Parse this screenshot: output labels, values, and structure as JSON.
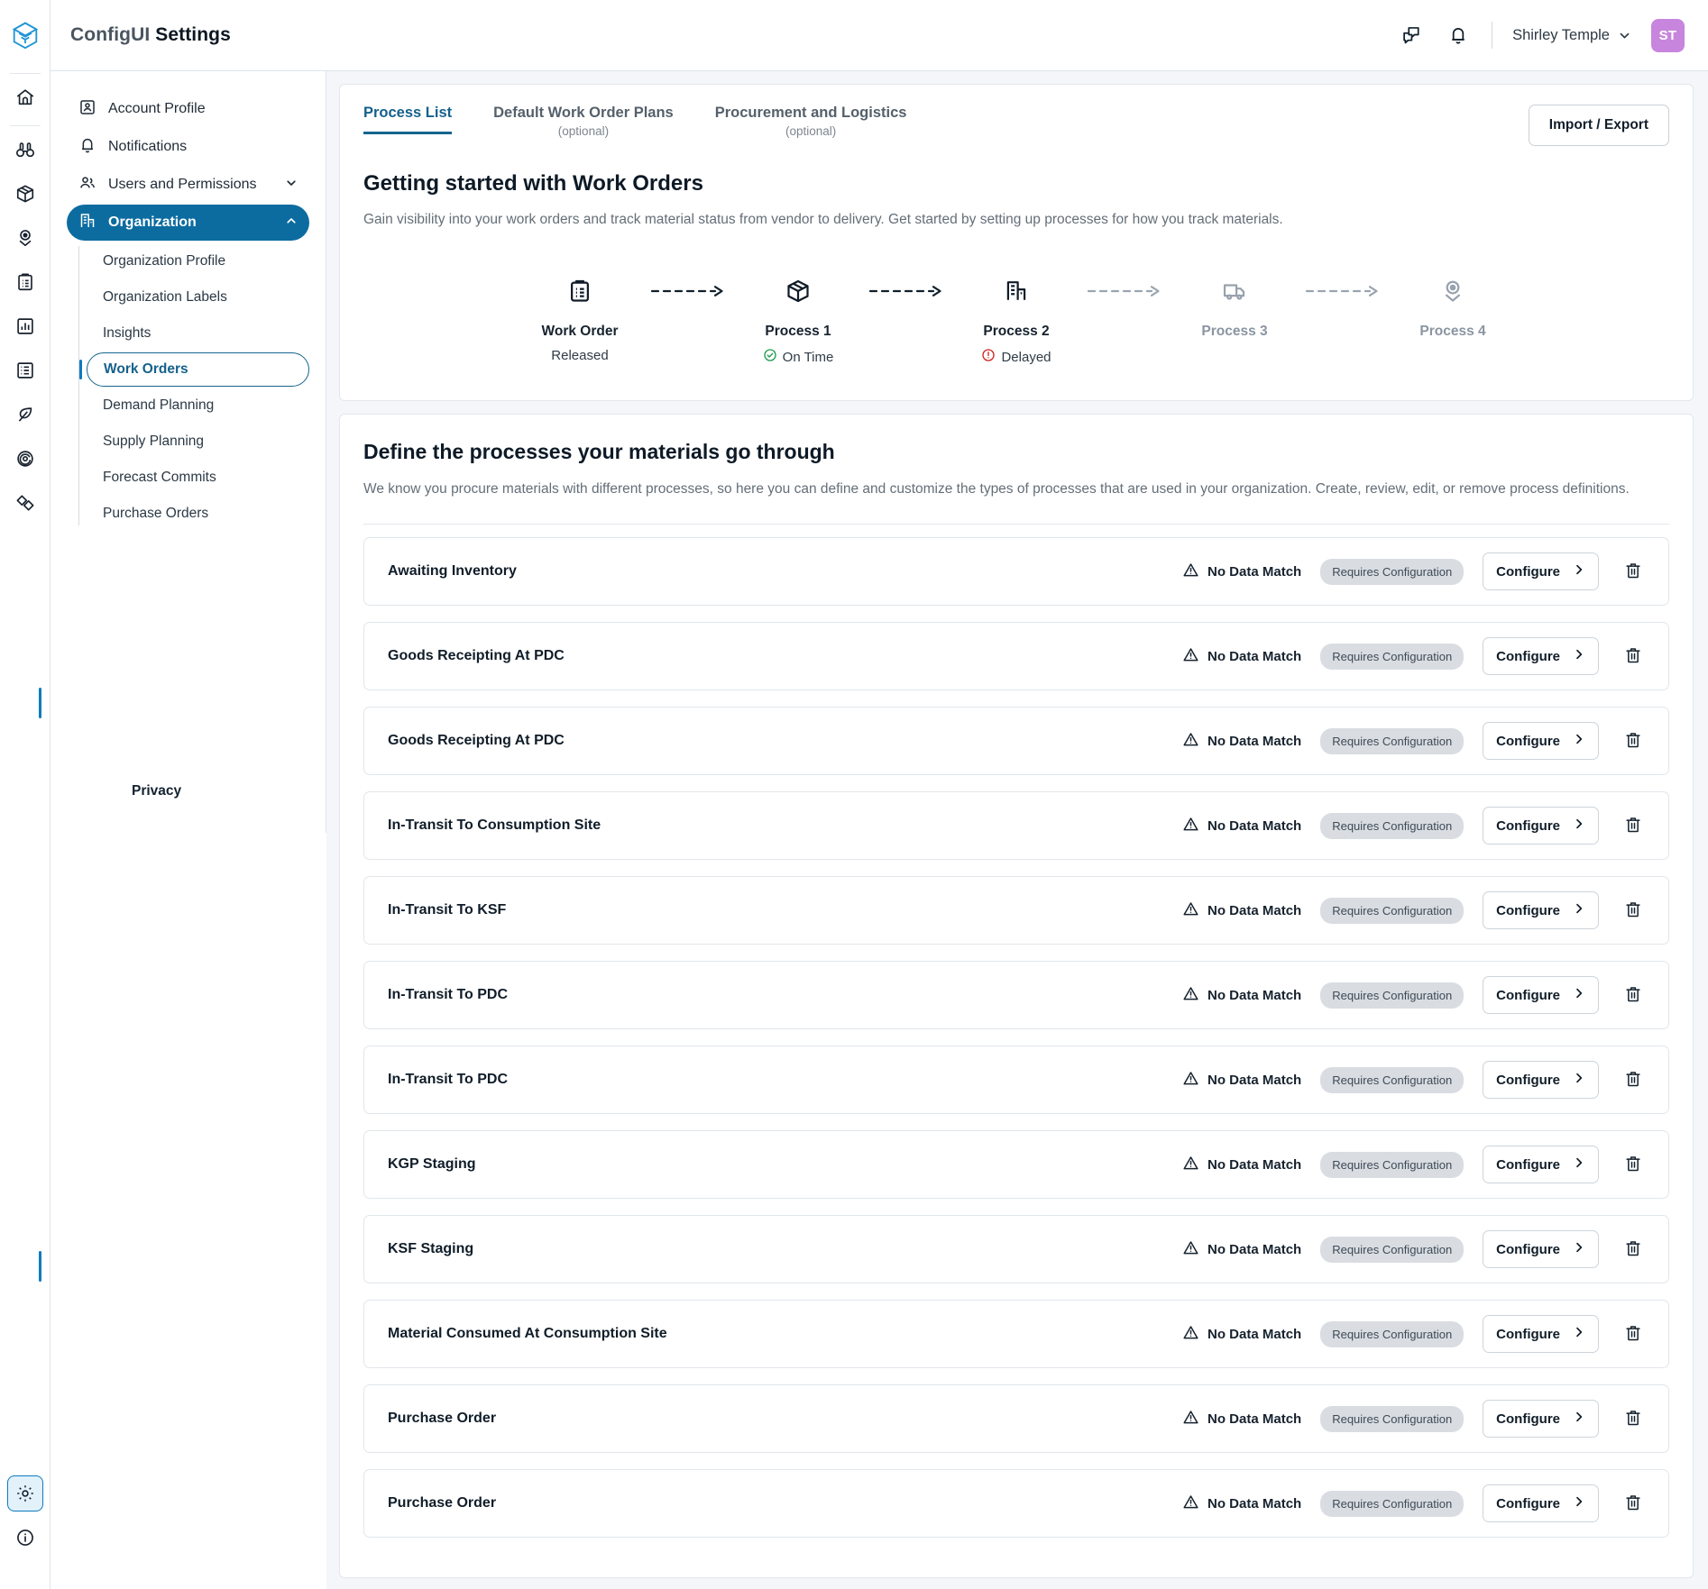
{
  "app": {
    "brand_light": "ConfigUI",
    "brand_bold": "Settings",
    "logo_icon": "cube-logo-icon"
  },
  "header": {
    "chat_icon": "chat-bubbles-icon",
    "bell_icon": "bell-icon",
    "user_name": "Shirley Temple",
    "user_chevron_icon": "chevron-down-icon",
    "avatar_initials": "ST",
    "avatar_color": "#c885dd"
  },
  "rail": {
    "items": [
      {
        "name": "home-icon"
      },
      {
        "name": "binoculars-icon"
      },
      {
        "name": "package-icon"
      },
      {
        "name": "location-pin-icon"
      },
      {
        "name": "clipboard-list-icon"
      },
      {
        "name": "bar-chart-icon"
      },
      {
        "name": "list-checks-icon"
      },
      {
        "name": "leaf-icon"
      },
      {
        "name": "target-spiral-icon"
      },
      {
        "name": "diamonds-icon"
      }
    ],
    "bottom_items": [
      {
        "name": "gear-icon",
        "active": true
      },
      {
        "name": "info-icon",
        "active": false
      }
    ]
  },
  "sidebar": {
    "items": [
      {
        "label": "Account Profile",
        "icon": "account-badge-icon",
        "selected": false,
        "expandable": false
      },
      {
        "label": "Notifications",
        "icon": "bell-icon",
        "selected": false,
        "expandable": false
      },
      {
        "label": "Users and Permissions",
        "icon": "users-icon",
        "selected": false,
        "expandable": true,
        "chevron": "chevron-down-icon"
      },
      {
        "label": "Organization",
        "icon": "building-icon",
        "selected": true,
        "expandable": true,
        "chevron": "chevron-up-icon"
      }
    ],
    "sub_items": [
      {
        "label": "Organization Profile",
        "selected": false
      },
      {
        "label": "Organization Labels",
        "selected": false
      },
      {
        "label": "Insights",
        "selected": false
      },
      {
        "label": "Work Orders",
        "selected": true
      },
      {
        "label": "Demand Planning",
        "selected": false
      },
      {
        "label": "Supply Planning",
        "selected": false
      },
      {
        "label": "Forecast Commits",
        "selected": false
      },
      {
        "label": "Purchase Orders",
        "selected": false
      }
    ],
    "privacy_label": "Privacy",
    "selected_color": "#0c6ca0"
  },
  "main": {
    "tabs": [
      {
        "label": "Process List",
        "sub": "",
        "active": true
      },
      {
        "label": "Default Work Order Plans",
        "sub": "(optional)",
        "active": false
      },
      {
        "label": "Procurement and Logistics",
        "sub": "(optional)",
        "active": false
      }
    ],
    "import_export_label": "Import / Export",
    "getting_started": {
      "title": "Getting started with Work Orders",
      "description": "Gain visibility into your work orders and track material status from vendor to delivery. Get started by setting up processes for how you track materials."
    },
    "flow": {
      "nodes": [
        {
          "title": "Work Order",
          "status": "Released",
          "status_type": "plain",
          "icon": "clipboard-list-icon",
          "muted": false
        },
        {
          "title": "Process 1",
          "status": "On Time",
          "status_type": "ontime",
          "icon": "package-icon",
          "muted": false
        },
        {
          "title": "Process 2",
          "status": "Delayed",
          "status_type": "delayed",
          "icon": "building-icon",
          "muted": false
        },
        {
          "title": "Process 3",
          "status": "",
          "status_type": "none",
          "icon": "truck-icon",
          "muted": true
        },
        {
          "title": "Process 4",
          "status": "",
          "status_type": "none",
          "icon": "location-pin-icon",
          "muted": true
        }
      ],
      "ontime_color": "#1f9a4d",
      "delayed_color": "#d42020"
    },
    "define_section": {
      "title": "Define the processes your materials go through",
      "description": "We know you procure materials with different processes, so here you can define and customize the types of processes that are used in your organization. Create, review, edit, or remove process definitions."
    },
    "row_defaults": {
      "status_label": "No Data Match",
      "status_icon": "warning-triangle-icon",
      "badge_label": "Requires Configuration",
      "configure_label": "Configure",
      "configure_icon": "chevron-right-icon",
      "delete_icon": "trash-icon"
    },
    "processes": [
      {
        "name": "Awaiting Inventory"
      },
      {
        "name": "Goods Receipting At PDC"
      },
      {
        "name": "Goods Receipting At PDC"
      },
      {
        "name": "In-Transit To Consumption Site"
      },
      {
        "name": "In-Transit To KSF"
      },
      {
        "name": "In-Transit To PDC"
      },
      {
        "name": "In-Transit To PDC"
      },
      {
        "name": "KGP Staging"
      },
      {
        "name": "KSF Staging"
      },
      {
        "name": "Material Consumed At Consumption Site"
      },
      {
        "name": "Purchase Order"
      },
      {
        "name": "Purchase Order"
      }
    ]
  }
}
